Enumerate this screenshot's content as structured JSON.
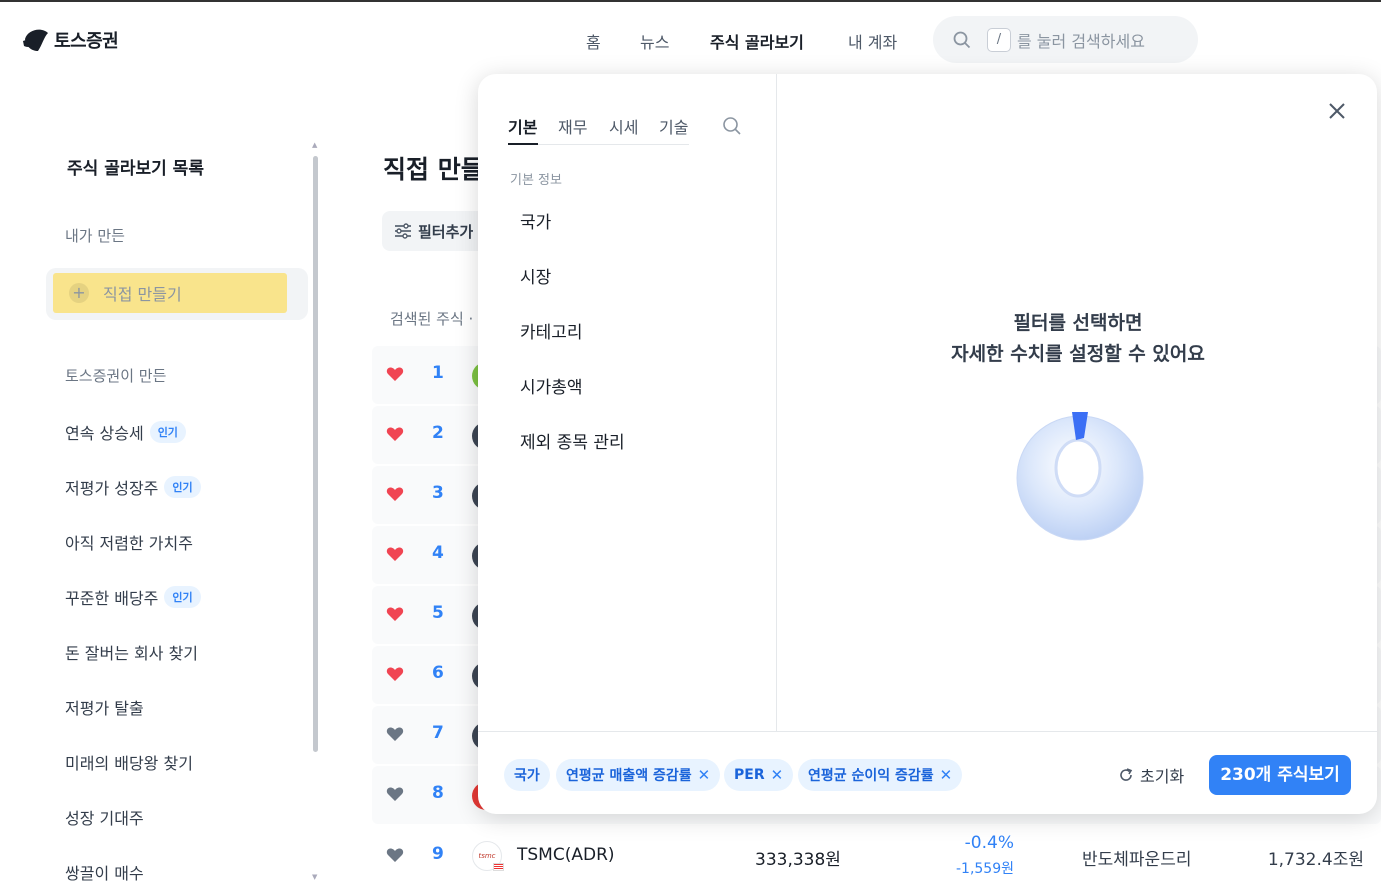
{
  "header": {
    "logo_text": "토스증권",
    "nav": [
      "홈",
      "뉴스",
      "주식 골라보기",
      "내 계좌"
    ],
    "search_key": "/",
    "search_placeholder": "를 눌러 검색하세요"
  },
  "sidebar": {
    "title": "주식 골라보기 목록",
    "mine_section": "내가 만든",
    "make_button": "직접 만들기",
    "toss_section": "토스증권이 만든",
    "items": [
      {
        "label": "연속 상승세",
        "badge": "인기"
      },
      {
        "label": "저평가 성장주",
        "badge": "인기"
      },
      {
        "label": "아직 저렴한 가치주",
        "badge": ""
      },
      {
        "label": "꾸준한 배당주",
        "badge": "인기"
      },
      {
        "label": "돈 잘버는 회사 찾기",
        "badge": ""
      },
      {
        "label": "저평가 탈출",
        "badge": ""
      },
      {
        "label": "미래의 배당왕 찾기",
        "badge": ""
      },
      {
        "label": "성장 기대주",
        "badge": ""
      },
      {
        "label": "쌍끌이 매수",
        "badge": ""
      }
    ]
  },
  "main": {
    "title": "직접 만들",
    "filter_add": "필터추가",
    "found_label": "검색된 주식 ·",
    "ranks": [
      "1",
      "2",
      "3",
      "4",
      "5",
      "6",
      "7",
      "8"
    ],
    "row9": {
      "rank": "9",
      "logo_text": "tsmc",
      "name": "TSMC(ADR)",
      "price": "333,338원",
      "change_pct": "-0.4%",
      "change_amt": "-1,559원",
      "industry": "반도체파운드리",
      "market_cap": "1,732.4조원"
    }
  },
  "modal": {
    "tabs": [
      "기본",
      "재무",
      "시세",
      "기술"
    ],
    "category_head": "기본 정보",
    "categories": [
      "국가",
      "시장",
      "카테고리",
      "시가총액",
      "제외 종목 관리"
    ],
    "empty_line1": "필터를 선택하면",
    "empty_line2": "자세한 수치를 설정할 수 있어요",
    "chips": [
      "국가",
      "연평균 매출액 증감률",
      "PER",
      "연평균 순이익 증감률"
    ],
    "reset_label": "초기화",
    "cta_label": "230개 주식보기"
  },
  "colors": {
    "accent": "#3182f6",
    "heart_red": "#f04452",
    "heart_gray": "#6b7684",
    "highlight": "#f9e48c"
  }
}
